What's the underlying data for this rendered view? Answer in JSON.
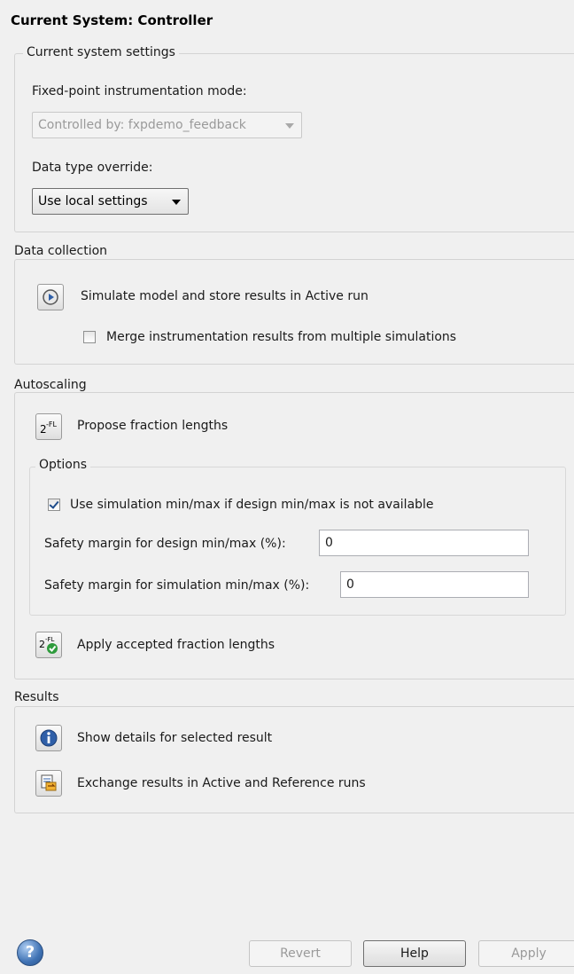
{
  "header": {
    "title": "Current System: Controller"
  },
  "current_settings": {
    "legend": "Current system settings",
    "instrumentation_label": "Fixed-point instrumentation mode:",
    "instrumentation_value": "Controlled by: fxpdemo_feedback",
    "override_label": "Data type override:",
    "override_value": "Use local settings"
  },
  "data_collection": {
    "legend": "Data collection",
    "simulate_label": "Simulate model and store results in Active run",
    "merge_label": "Merge instrumentation results from multiple simulations",
    "merge_checked": false
  },
  "autoscaling": {
    "legend": "Autoscaling",
    "propose_label": "Propose fraction lengths",
    "options": {
      "legend": "Options",
      "use_sim_label": "Use simulation min/max if design min/max is not available",
      "use_sim_checked": true,
      "design_margin_label": "Safety margin for design min/max (%):",
      "design_margin_value": "0",
      "sim_margin_label": "Safety margin for simulation min/max (%):",
      "sim_margin_value": "0"
    },
    "apply_label": "Apply accepted fraction lengths"
  },
  "results": {
    "legend": "Results",
    "details_label": "Show details for selected result",
    "exchange_label": "Exchange results in Active and Reference runs"
  },
  "footer": {
    "help_icon_glyph": "?",
    "revert_label": "Revert",
    "help_label": "Help",
    "apply_label": "Apply"
  }
}
